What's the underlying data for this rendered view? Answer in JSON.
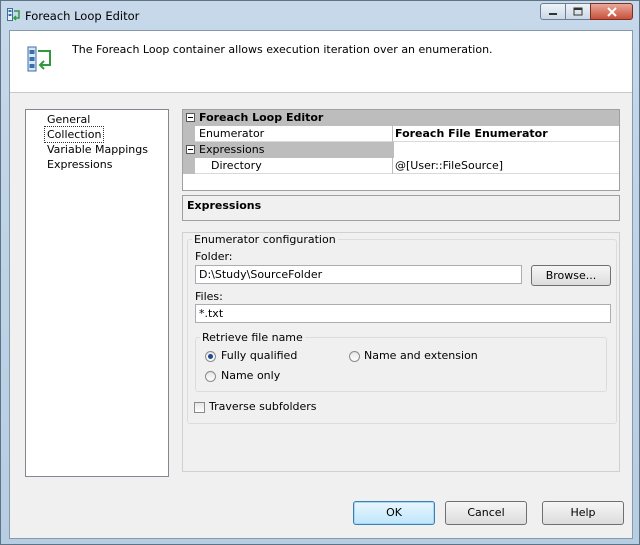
{
  "window": {
    "title": "Foreach Loop Editor"
  },
  "header": {
    "description": "The Foreach Loop container allows execution iteration over an enumeration."
  },
  "nav": {
    "items": [
      {
        "label": "General"
      },
      {
        "label": "Collection"
      },
      {
        "label": "Variable Mappings"
      },
      {
        "label": "Expressions"
      }
    ],
    "selected": "Collection"
  },
  "grid": {
    "category": "Foreach Loop Editor",
    "enumerator": {
      "name": "Enumerator",
      "value": "Foreach File Enumerator"
    },
    "expressions": {
      "name": "Expressions"
    },
    "directory": {
      "name": "Directory",
      "value": "@[User::FileSource]"
    }
  },
  "description_pane": {
    "title": "Expressions"
  },
  "config": {
    "group_label": "Enumerator configuration",
    "folder_label": "Folder:",
    "folder_value": "D:\\Study\\SourceFolder",
    "browse_label": "Browse...",
    "files_label": "Files:",
    "files_value": "*.txt",
    "retrieve_label": "Retrieve file name",
    "options": {
      "fully_qualified": "Fully qualified",
      "name_and_extension": "Name and extension",
      "name_only": "Name only"
    },
    "selected_option": "Fully qualified",
    "traverse_label": "Traverse subfolders",
    "traverse_checked": false
  },
  "buttons": {
    "ok": "OK",
    "cancel": "Cancel",
    "help": "Help"
  }
}
